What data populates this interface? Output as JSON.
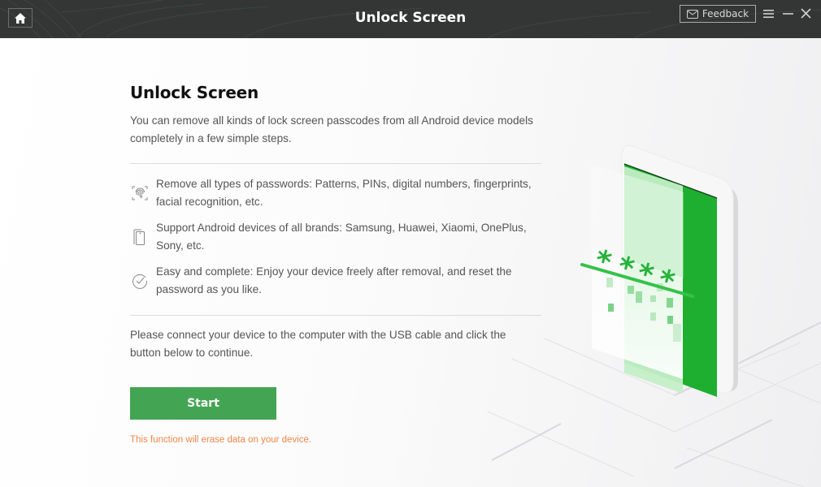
{
  "titlebar": {
    "title": "Unlock Screen",
    "home_icon": "home-icon",
    "feedback_label": "Feedback",
    "feedback_icon": "mail-icon",
    "menu_icon": "hamburger-menu-icon",
    "minimize_icon": "minimize-icon",
    "close_icon": "close-icon"
  },
  "main": {
    "heading": "Unlock Screen",
    "intro": "You can remove all kinds of lock screen passcodes from all Android device models completely in a few simple steps.",
    "features": [
      {
        "icon": "fingerprint-icon",
        "text": "Remove all types of passwords: Patterns, PINs, digital numbers, fingerprints, facial recognition, etc."
      },
      {
        "icon": "phone-devices-icon",
        "text": "Support Android devices of all brands: Samsung, Huawei, Xiaomi, OnePlus, Sony, etc."
      },
      {
        "icon": "check-circle-icon",
        "text": "Easy and complete: Enjoy your device freely after removal, and reset the password as you like."
      }
    ],
    "connect_text": "Please connect your device to the computer with the USB cable and click the button below to continue.",
    "start_label": "Start",
    "warning": "This function will erase data on your device."
  },
  "illustration": {
    "password_mask": "****",
    "description": "phone-unlock-illustration"
  },
  "colors": {
    "titlebar_bg": "#343635",
    "accent_green": "#43a553",
    "screen_green": "#1faf30",
    "warning_orange": "#f0874a",
    "text_gray": "#555555"
  }
}
